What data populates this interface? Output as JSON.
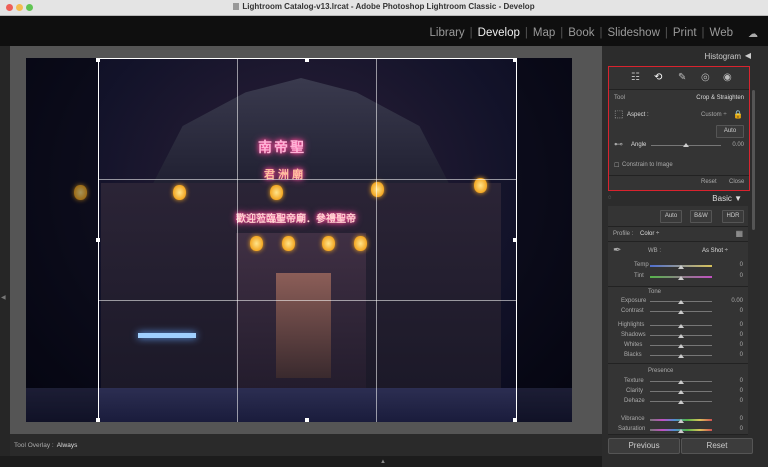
{
  "window": {
    "title": "Lightroom Catalog-v13.lrcat - Adobe Photoshop Lightroom Classic - Develop"
  },
  "modules": [
    {
      "label": "Library",
      "active": false
    },
    {
      "label": "Develop",
      "active": true
    },
    {
      "label": "Map",
      "active": false
    },
    {
      "label": "Book",
      "active": false
    },
    {
      "label": "Slideshow",
      "active": false
    },
    {
      "label": "Print",
      "active": false
    },
    {
      "label": "Web",
      "active": false
    }
  ],
  "photo_text": {
    "sign_top": "南帝聖",
    "sign_mid": "君 洲 廟",
    "banner": "歡迎蒞臨聖帝廟．參禮聖帝"
  },
  "toolbar": {
    "overlay_label": "Tool Overlay :",
    "overlay_value": "Always"
  },
  "histogram": {
    "label": "Histogram",
    "arrow": "◀"
  },
  "crop": {
    "tool_label": "Tool",
    "tool_name": "Crop & Straighten",
    "aspect_label": "Aspect :",
    "aspect_value": "Custom ÷",
    "auto_label": "Auto",
    "angle_label": "Angle",
    "angle_value": "0.00",
    "constrain_label": "Constrain to Image",
    "reset_label": "Reset",
    "close_label": "Close"
  },
  "basic": {
    "title": "Basic",
    "arrow": "▼",
    "auto": "Auto",
    "bw": "B&W",
    "hdr": "HDR",
    "profile_label": "Profile :",
    "profile_value": "Color ÷",
    "wb_label": "WB :",
    "wb_value": "As Shot ÷",
    "temp": {
      "label": "Temp",
      "value": "0"
    },
    "tint": {
      "label": "Tint",
      "value": "0"
    },
    "tone_title": "Tone",
    "exposure": {
      "label": "Exposure",
      "value": "0.00"
    },
    "contrast": {
      "label": "Contrast",
      "value": "0"
    },
    "highlights": {
      "label": "Highlights",
      "value": "0"
    },
    "shadows": {
      "label": "Shadows",
      "value": "0"
    },
    "whites": {
      "label": "Whites",
      "value": "0"
    },
    "blacks": {
      "label": "Blacks",
      "value": "0"
    },
    "presence_title": "Presence",
    "texture": {
      "label": "Texture",
      "value": "0"
    },
    "clarity": {
      "label": "Clarity",
      "value": "0"
    },
    "dehaze": {
      "label": "Dehaze",
      "value": "0"
    },
    "vibrance": {
      "label": "Vibrance",
      "value": "0"
    },
    "saturation": {
      "label": "Saturation",
      "value": "0"
    }
  },
  "buttons": {
    "previous": "Previous",
    "reset": "Reset"
  },
  "colors": {
    "accent_red": "#d9232e",
    "panel_bg": "#2c2c2c",
    "work_bg": "#555555"
  }
}
